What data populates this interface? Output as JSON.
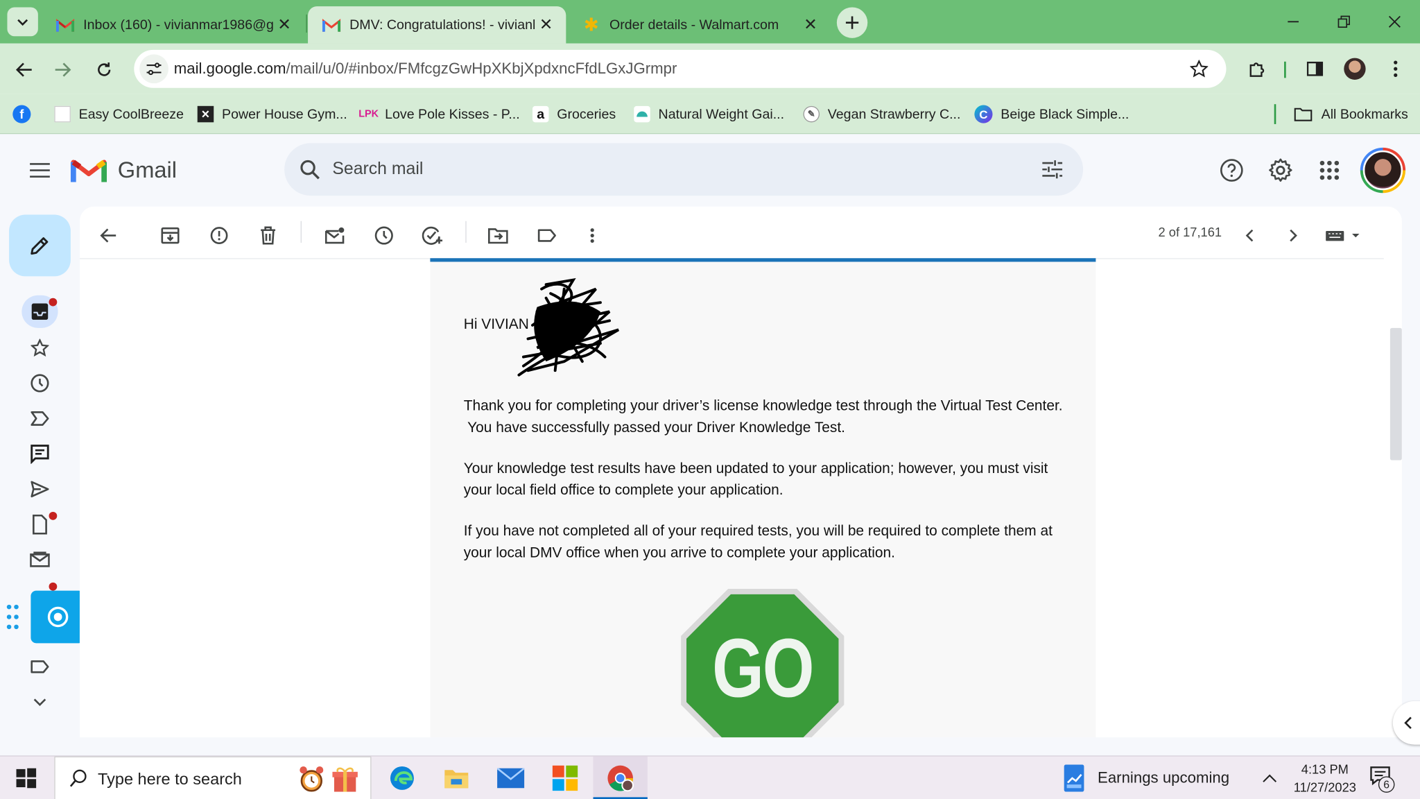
{
  "browser": {
    "tabs": [
      {
        "title": "Inbox (160) - vivianmar1986@g",
        "favicon": "gmail-icon"
      },
      {
        "title": "DMV: Congratulations! - vivianl",
        "favicon": "gmail-icon"
      },
      {
        "title": "Order details - Walmart.com",
        "favicon": "walmart-icon"
      }
    ],
    "url_host": "mail.google.com",
    "url_path": "/mail/u/0/#inbox/FMfcgzGwHpXKbjXpdxncFfdLGxJGrmpr",
    "bookmarks": [
      {
        "label": "",
        "icon": "facebook-icon"
      },
      {
        "label": "Easy CoolBreeze",
        "icon": "page-icon"
      },
      {
        "label": "Power House Gym...",
        "icon": "gym-icon"
      },
      {
        "label": "Love Pole Kisses - P...",
        "icon": "lpk-icon"
      },
      {
        "label": "Groceries",
        "icon": "amazon-icon"
      },
      {
        "label": "Natural Weight Gai...",
        "icon": "weight-icon"
      },
      {
        "label": "Vegan Strawberry C...",
        "icon": "vegan-icon"
      },
      {
        "label": "Beige Black Simple...",
        "icon": "canva-icon"
      }
    ],
    "all_bookmarks_label": "All Bookmarks",
    "colors": {
      "frame": "#6cbf76",
      "toolbar": "#d6ecd6"
    }
  },
  "gmail": {
    "logo_text": "Gmail",
    "search_placeholder": "Search mail",
    "pagination": "2 of 17,161"
  },
  "email": {
    "greeting": "Hi VIVIAN",
    "para1_line1": "Thank you for completing your driver’s license knowledge test through the Virtual Test Center.",
    "para1_line2": " You have successfully passed your Driver Knowledge Test.",
    "para2_line1": "Your knowledge test results have been updated to your application; however, you must visit",
    "para2_line2": "your local field office to complete your application.",
    "para3_line1": "If you have not completed all of your required tests, you will be required to complete them at",
    "para3_line2": "your local DMV office when you arrive to complete your application.",
    "go_sign_text": "GO"
  },
  "taskbar": {
    "search_placeholder": "Type here to search",
    "news_label": "Earnings upcoming",
    "time": "4:13 PM",
    "date": "11/27/2023",
    "notification_count": "6"
  }
}
